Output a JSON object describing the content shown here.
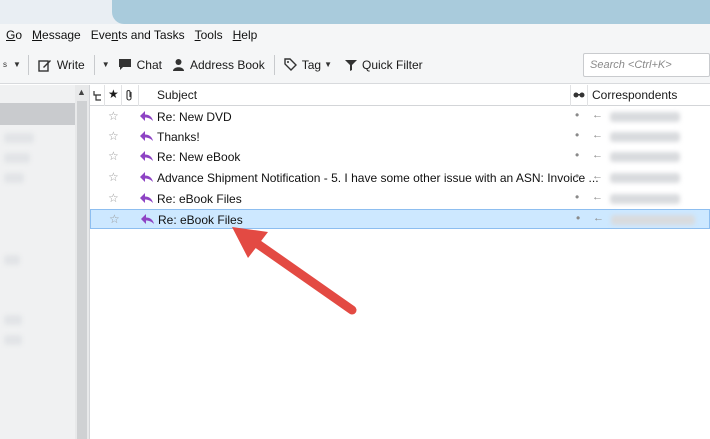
{
  "menubar": {
    "items": [
      {
        "label": "Go",
        "accel": "G"
      },
      {
        "label": "Message",
        "accel": "M"
      },
      {
        "label": "Events and Tasks",
        "accel": "n"
      },
      {
        "label": "Tools",
        "accel": "T"
      },
      {
        "label": "Help",
        "accel": "H"
      }
    ]
  },
  "toolbar": {
    "write_label": "Write",
    "chat_label": "Chat",
    "address_book_label": "Address Book",
    "tag_label": "Tag",
    "quick_filter_label": "Quick Filter",
    "search_placeholder": "Search <Ctrl+K>"
  },
  "thread_pane": {
    "columns": {
      "subject": "Subject",
      "correspondents": "Correspondents"
    },
    "rows": [
      {
        "subject": "Re: New DVD",
        "selected": false
      },
      {
        "subject": "Thanks!",
        "selected": false
      },
      {
        "subject": "Re: New eBook",
        "selected": false
      },
      {
        "subject": "Advance Shipment Notification - 5. I have some other issue with an ASN: Invoice ...",
        "selected": false
      },
      {
        "subject": "Re: eBook Files",
        "selected": false
      },
      {
        "subject": "Re: eBook Files",
        "selected": true
      }
    ]
  },
  "colors": {
    "selection_bg": "#cde8ff",
    "reply_icon": "#8e44c4",
    "annotation_arrow": "#e34a43"
  }
}
